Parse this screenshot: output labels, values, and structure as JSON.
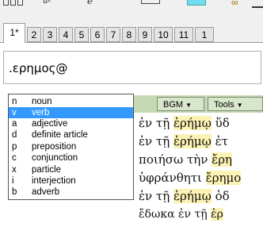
{
  "tabs": [
    "1*",
    "2",
    "3",
    "4",
    "5",
    "6",
    "7",
    "8",
    "9",
    "10",
    "11",
    "1"
  ],
  "active_tab": "1*",
  "search": {
    "value": ".ερημος@"
  },
  "buttons": {
    "bgm": "BGM",
    "tools": "Tools"
  },
  "pos_list": [
    {
      "code": "n",
      "label": "noun",
      "selected": false
    },
    {
      "code": "v",
      "label": "verb",
      "selected": true
    },
    {
      "code": "a",
      "label": "adjective",
      "selected": false
    },
    {
      "code": "d",
      "label": "definite article",
      "selected": false
    },
    {
      "code": "p",
      "label": "preposition",
      "selected": false
    },
    {
      "code": "c",
      "label": "conjunction",
      "selected": false
    },
    {
      "code": "x",
      "label": "particle",
      "selected": false
    },
    {
      "code": "i",
      "label": "interjection",
      "selected": false
    },
    {
      "code": "b",
      "label": "adverb",
      "selected": false
    }
  ],
  "verses": [
    {
      "before": "ἐν τῇ ",
      "hit": "ἐρήμῳ",
      "after": " ὕδ"
    },
    {
      "before": "ἐν τῇ ",
      "hit": "ἐρήμῳ",
      "after": " ἐτ"
    },
    {
      "before": "ποιήσω τὴν ",
      "hit": "ἔρη",
      "after": ""
    },
    {
      "before": "ὑφράνθητι ",
      "hit": "ἔρημο",
      "after": ""
    },
    {
      "before": "ἐν τῇ ",
      "hit": "ἐρήμῳ",
      "after": " ὁδ"
    },
    {
      "before": "ἔδωκα ἐν τῇ ",
      "hit": "ἐρ",
      "after": ""
    }
  ],
  "colors": {
    "selection": "#3399ff",
    "highlight": "#fbf2b4",
    "button_bar": "#c4d9b4"
  }
}
